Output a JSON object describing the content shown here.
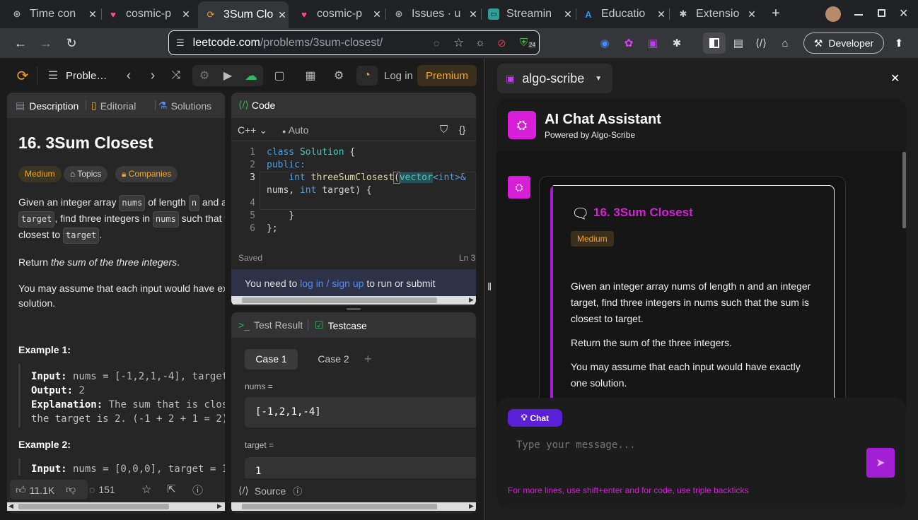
{
  "tabs": [
    {
      "title": "Time con",
      "icon": "github-icon"
    },
    {
      "title": "cosmic-p",
      "icon": "heart-icon"
    },
    {
      "title": "3Sum Clo",
      "icon": "leetcode-icon"
    },
    {
      "title": "cosmic-p",
      "icon": "heart-icon"
    },
    {
      "title": "Issues · u",
      "icon": "github-icon"
    },
    {
      "title": "Streamin",
      "icon": "stream-icon"
    },
    {
      "title": "Educatio",
      "icon": "azure-icon"
    },
    {
      "title": "Extensio",
      "icon": "puzzle-icon"
    }
  ],
  "browser": {
    "url_host": "leetcode.com",
    "url_path": "/problems/3sum-closest/",
    "ext_badge": "24",
    "developer_label": "Developer"
  },
  "lc_nav": {
    "problems_label": "Proble…",
    "login_label": "Log in",
    "premium_label": "Premium"
  },
  "left_tabs": {
    "description": "Description",
    "editorial": "Editorial",
    "solutions": "Solutions"
  },
  "problem": {
    "title": "16. 3Sum Closest",
    "difficulty": "Medium",
    "topics": "Topics",
    "companies": "Companies",
    "p1_a": "Given an integer array ",
    "p1_nums": "nums",
    "p1_b": " of length ",
    "p1_n": "n",
    "p1_c": " and a",
    "p1_target": "target",
    "p1_d": ", find three integers in ",
    "p1_nums2": "nums",
    "p1_e": " such that t",
    "p1_f": "closest to ",
    "p1_target2": "target",
    "p1_g": ".",
    "p2_a": "Return ",
    "p2_em": "the sum of the three integers",
    "p2_b": ".",
    "p3_a": "You may assume that each input would have ex",
    "p3_b": "solution.",
    "ex1_title": "Example 1:",
    "ex1_in_l": "Input:",
    "ex1_in": " nums = [-1,2,1,-4], target",
    "ex1_out_l": "Output:",
    "ex1_out": " 2",
    "ex1_exp_l": "Explanation:",
    "ex1_exp": " The sum that is clos",
    "ex1_exp2": "the target is 2. (-1 + 2 + 1 = 2)",
    "ex2_title": "Example 2:",
    "ex2_in_l": "Input:",
    "ex2_in": " nums = [0,0,0], target = 1"
  },
  "bottom_bar": {
    "likes": "11.1K",
    "comments": "151"
  },
  "code_panel": {
    "title": "Code",
    "language": "C++",
    "auto": "Auto",
    "status": "Saved",
    "cursor": "Ln 3",
    "notice_a": "You need to ",
    "notice_link": "log in / sign up",
    "notice_b": " to run or submit",
    "lines": [
      "1",
      "2",
      "3",
      "",
      "4",
      "5",
      "6"
    ],
    "code": {
      "l1_kw": "class",
      "l1_ty": "Solution",
      "l1_p": " {",
      "l2": "public:",
      "l3_kw": "int",
      "l3_fn": "threeSumClosest",
      "l3_p": "(",
      "l3_ty": "vector",
      "l3_t": "<int>&",
      "l4_a": "nums, ",
      "l4_kw": "int",
      "l4_b": " target) {",
      "l6": "}",
      "l7": "};"
    }
  },
  "test_panel": {
    "result_tab": "Test Result",
    "testcase_tab": "Testcase",
    "case1": "Case 1",
    "case2": "Case 2",
    "nums_label": "nums =",
    "nums_val": "[-1,2,1,-4]",
    "target_label": "target =",
    "target_val": "1",
    "source": "Source"
  },
  "ext": {
    "name": "algo-scribe",
    "header_title": "AI Chat Assistant",
    "header_sub": "Powered by Algo-Scribe",
    "card_title": "16. 3Sum Closest",
    "card_diff": "Medium",
    "card_p1": "Given an integer array nums of length n and an integer target, find three integers in nums such that the sum is closest to target.",
    "card_p2": "Return the sum of the three integers.",
    "card_p3": "You may assume that each input would have exactly one solution.",
    "chat_btn": "Chat",
    "placeholder": "Type your message...",
    "hint": "For more lines, use shift+enter and for code, use triple backticks",
    "accent": "#d61fd6",
    "chat_btn_color": "#5b21d8"
  }
}
